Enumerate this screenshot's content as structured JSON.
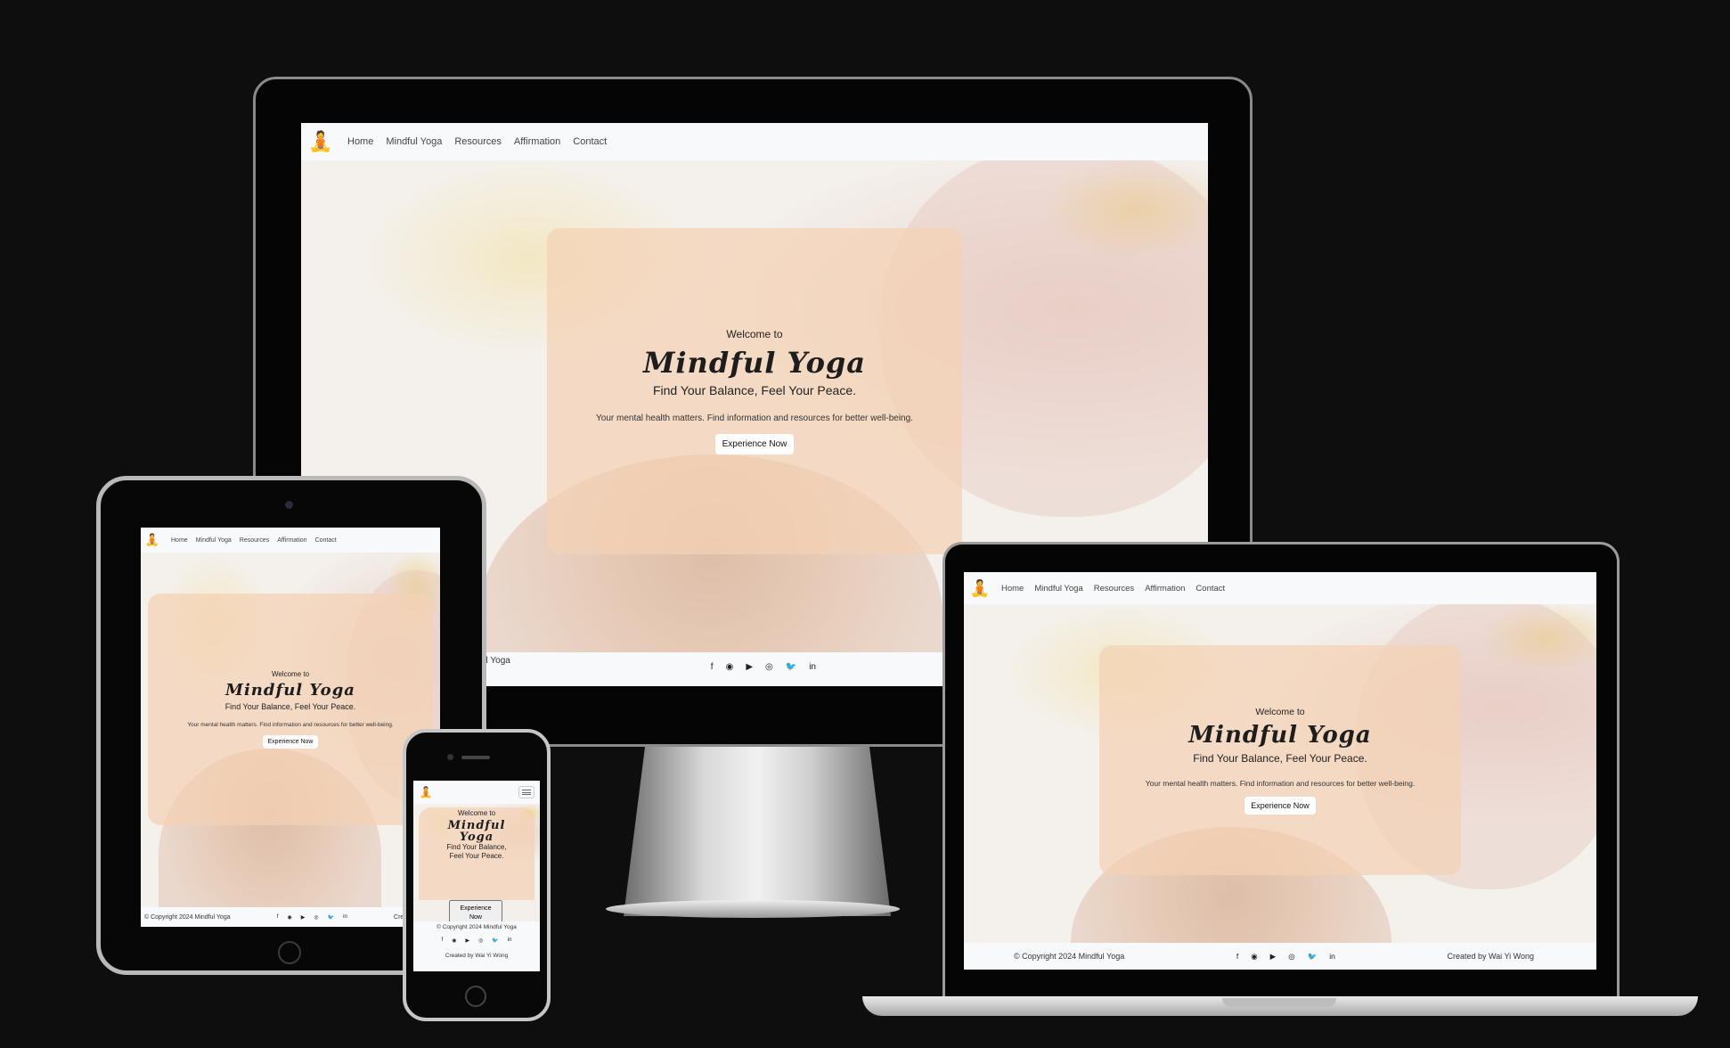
{
  "site": {
    "nav": [
      "Home",
      "Mindful Yoga",
      "Resources",
      "Affirmation",
      "Contact"
    ],
    "welcome": "Welcome to",
    "brand": "Mindful Yoga",
    "brand_mobile_1": "Mindful",
    "brand_mobile_2": "Yoga",
    "tagline": "Find Your Balance, Feel Your Peace.",
    "tagline_mobile": "Find Your Balance, Feel Your Peace.",
    "blurb": "Your mental health matters. Find information and resources for better well-being.",
    "cta": "Experience Now",
    "copyright": "© Copyright 2024 Mindful Yoga",
    "copyright_partial_imac": "ul Yoga",
    "created_by": "Created by Wai Yi Wong",
    "created_by_partial_ipad": "Created by Wai",
    "social": [
      "facebook-icon",
      "github-icon",
      "youtube-icon",
      "instagram-icon",
      "twitter-icon",
      "linkedin-icon"
    ]
  },
  "glyphs": {
    "facebook": "f",
    "github": "◉",
    "youtube": "▶",
    "instagram": "◎",
    "twitter": "🐦",
    "linkedin": "in",
    "logo": "🧘"
  },
  "colors": {
    "background": "#0e0e0f",
    "card": "#f4d1b4",
    "nav": "#f8f9fa"
  }
}
